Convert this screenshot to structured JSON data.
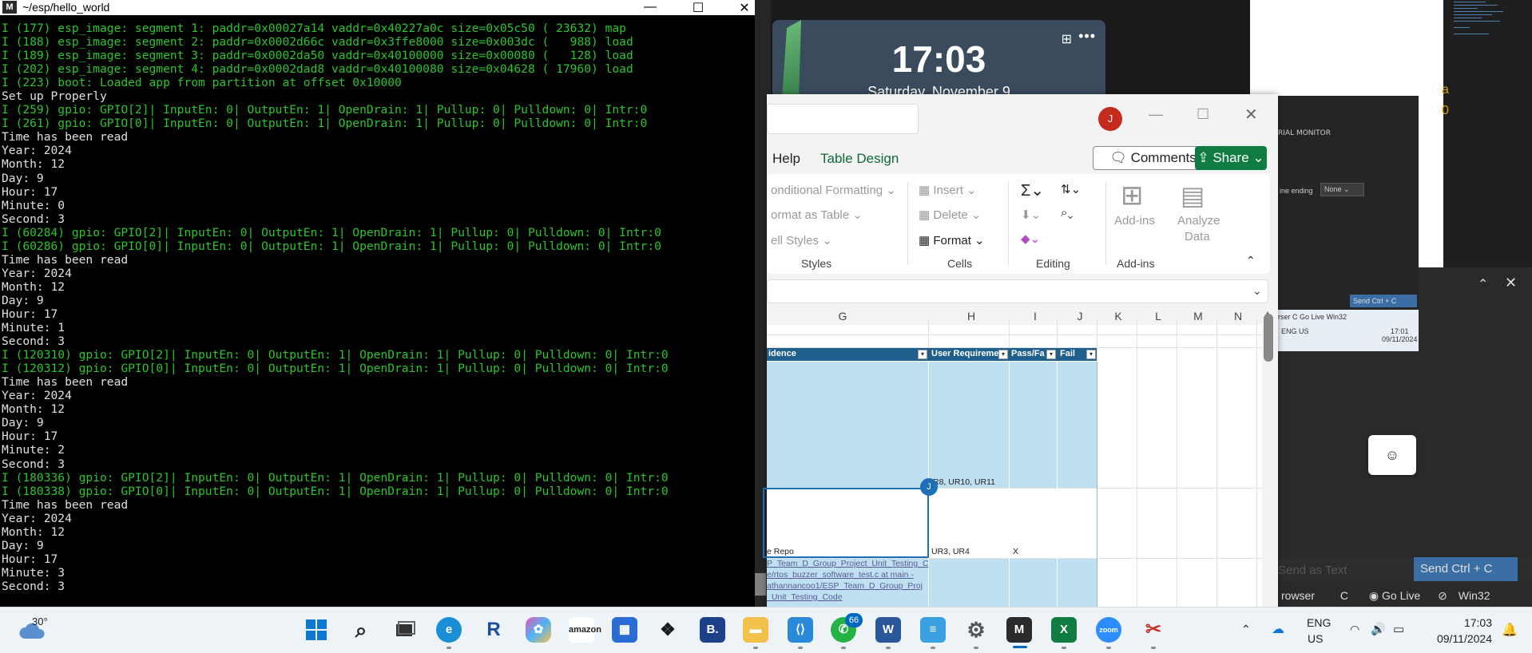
{
  "terminal": {
    "title": "~/esp/hello_world",
    "app_icon": "M",
    "lines": [
      {
        "t": "I (177) esp_image: segment 1: paddr=0x00027a14 vaddr=0x40227a0c size=0x05c50 ( 23632) map",
        "c": "g"
      },
      {
        "t": "I (188) esp_image: segment 2: paddr=0x0002d66c vaddr=0x3ffe8000 size=0x003dc (   988) load",
        "c": "g"
      },
      {
        "t": "I (189) esp_image: segment 3: paddr=0x0002da50 vaddr=0x40100000 size=0x00080 (   128) load",
        "c": "g"
      },
      {
        "t": "I (202) esp_image: segment 4: paddr=0x0002dad8 vaddr=0x40100080 size=0x04628 ( 17960) load",
        "c": "g"
      },
      {
        "t": "I (223) boot: Loaded app from partition at offset 0x10000",
        "c": "g"
      },
      {
        "t": "Set up Properly",
        "c": "w"
      },
      {
        "t": "I (259) gpio: GPIO[2]| InputEn: 0| OutputEn: 1| OpenDrain: 1| Pullup: 0| Pulldown: 0| Intr:0",
        "c": "g"
      },
      {
        "t": "I (261) gpio: GPIO[0]| InputEn: 0| OutputEn: 1| OpenDrain: 1| Pullup: 0| Pulldown: 0| Intr:0",
        "c": "g"
      },
      {
        "t": "Time has been read",
        "c": "w"
      },
      {
        "t": "Year: 2024",
        "c": "w"
      },
      {
        "t": "Month: 12",
        "c": "w"
      },
      {
        "t": "Day: 9",
        "c": "w"
      },
      {
        "t": "Hour: 17",
        "c": "w"
      },
      {
        "t": "Minute: 0",
        "c": "w"
      },
      {
        "t": "Second: 3",
        "c": "w"
      },
      {
        "t": "I (60284) gpio: GPIO[2]| InputEn: 0| OutputEn: 1| OpenDrain: 1| Pullup: 0| Pulldown: 0| Intr:0",
        "c": "g"
      },
      {
        "t": "I (60286) gpio: GPIO[0]| InputEn: 0| OutputEn: 1| OpenDrain: 1| Pullup: 0| Pulldown: 0| Intr:0",
        "c": "g"
      },
      {
        "t": "Time has been read",
        "c": "w"
      },
      {
        "t": "Year: 2024",
        "c": "w"
      },
      {
        "t": "Month: 12",
        "c": "w"
      },
      {
        "t": "Day: 9",
        "c": "w"
      },
      {
        "t": "Hour: 17",
        "c": "w"
      },
      {
        "t": "Minute: 1",
        "c": "w"
      },
      {
        "t": "Second: 3",
        "c": "w"
      },
      {
        "t": "I (120310) gpio: GPIO[2]| InputEn: 0| OutputEn: 1| OpenDrain: 1| Pullup: 0| Pulldown: 0| Intr:0",
        "c": "g"
      },
      {
        "t": "I (120312) gpio: GPIO[0]| InputEn: 0| OutputEn: 1| OpenDrain: 1| Pullup: 0| Pulldown: 0| Intr:0",
        "c": "g"
      },
      {
        "t": "Time has been read",
        "c": "w"
      },
      {
        "t": "Year: 2024",
        "c": "w"
      },
      {
        "t": "Month: 12",
        "c": "w"
      },
      {
        "t": "Day: 9",
        "c": "w"
      },
      {
        "t": "Hour: 17",
        "c": "w"
      },
      {
        "t": "Minute: 2",
        "c": "w"
      },
      {
        "t": "Second: 3",
        "c": "w"
      },
      {
        "t": "I (180336) gpio: GPIO[2]| InputEn: 0| OutputEn: 1| OpenDrain: 1| Pullup: 0| Pulldown: 0| Intr:0",
        "c": "g"
      },
      {
        "t": "I (180338) gpio: GPIO[0]| InputEn: 0| OutputEn: 1| OpenDrain: 1| Pullup: 0| Pulldown: 0| Intr:0",
        "c": "g"
      },
      {
        "t": "Time has been read",
        "c": "w"
      },
      {
        "t": "Year: 2024",
        "c": "w"
      },
      {
        "t": "Month: 12",
        "c": "w"
      },
      {
        "t": "Day: 9",
        "c": "w"
      },
      {
        "t": "Hour: 17",
        "c": "w"
      },
      {
        "t": "Minute: 3",
        "c": "w"
      },
      {
        "t": "Second: 3",
        "c": "w"
      }
    ],
    "colors": {
      "green": "#2cc42c",
      "white": "#e0e0e0",
      "background": "#000000"
    }
  },
  "clock_widget": {
    "time": "17:03",
    "date": "Saturday, November 9",
    "add_icon": "add-widget-icon",
    "more_icon": "more-icon"
  },
  "excel": {
    "avatar_initial": "J",
    "tabs": {
      "help": "Help",
      "table_design": "Table Design"
    },
    "comments_label": "Comments",
    "share_label": "Share",
    "ribbon": {
      "conditional_formatting": "onditional Formatting",
      "format_as_table": "ormat as Table",
      "cell_styles": "ell Styles",
      "styles_group": "Styles",
      "insert": "Insert",
      "delete": "Delete",
      "format": "Format",
      "cells_group": "Cells",
      "editing_group": "Editing",
      "add_ins": "Add-ins",
      "add_ins_group": "Add-ins",
      "analyze_data_line1": "Analyze",
      "analyze_data_line2": "Data"
    },
    "columns": [
      "G",
      "H",
      "I",
      "J",
      "K",
      "L",
      "M",
      "N"
    ],
    "table_headers": {
      "evidence": "idence",
      "user_requirements": "User Requiremen",
      "pass_fail": "Pass/Fa",
      "fail": "Fail"
    },
    "cells": {
      "row1_h": "R8, UR10, UR11",
      "row2_g": "e Repo",
      "row2_h": "UR3, UR4",
      "row2_i": "X",
      "row3_link": [
        "P_Team_D_Group_Project_Unit_Testing_C",
        "e/rtos_buzzer_software_test.c at main -",
        "athannancoo1/ESP_Team_D_Group_Proj",
        "_Unit_Testing_Code"
      ]
    },
    "selection_avatar": "J"
  },
  "background_app": {
    "serial_monitor_title": "RIAL MONITOR",
    "line_ending_label": "ine ending",
    "line_ending_value": "None",
    "mini_send": "Send Ctrl + C",
    "mini_taskbar_text": "rser   C   Go Live   Win32",
    "mini_lang": "ENG US",
    "mini_time": "17:01",
    "mini_date": "09/11/2024",
    "send_as_text_placeholder": "Send as Text",
    "send_button": "Send Ctrl + C",
    "status_browser": "rowser",
    "status_c": "C",
    "status_golive": "Go Live",
    "status_platform": "Win32",
    "edge_glyph_a": "a",
    "edge_glyph_0": "0"
  },
  "taskbar": {
    "weather_temp": "30°",
    "whatsapp_badge": "66",
    "lang_line1": "ENG",
    "lang_line2": "US",
    "time": "17:03",
    "date": "09/11/2024",
    "icons": [
      "start-icon",
      "search-icon",
      "task-view-icon",
      "edge-icon",
      "r-app-icon",
      "copilot-icon",
      "amazon-icon",
      "store-icon",
      "dropbox-icon",
      "b-app-icon",
      "file-explorer-icon",
      "vscode-icon",
      "whatsapp-icon",
      "word-icon",
      "notepad-icon",
      "settings-icon",
      "msys-icon",
      "excel-icon",
      "zoom-icon",
      "snipping-icon"
    ]
  }
}
